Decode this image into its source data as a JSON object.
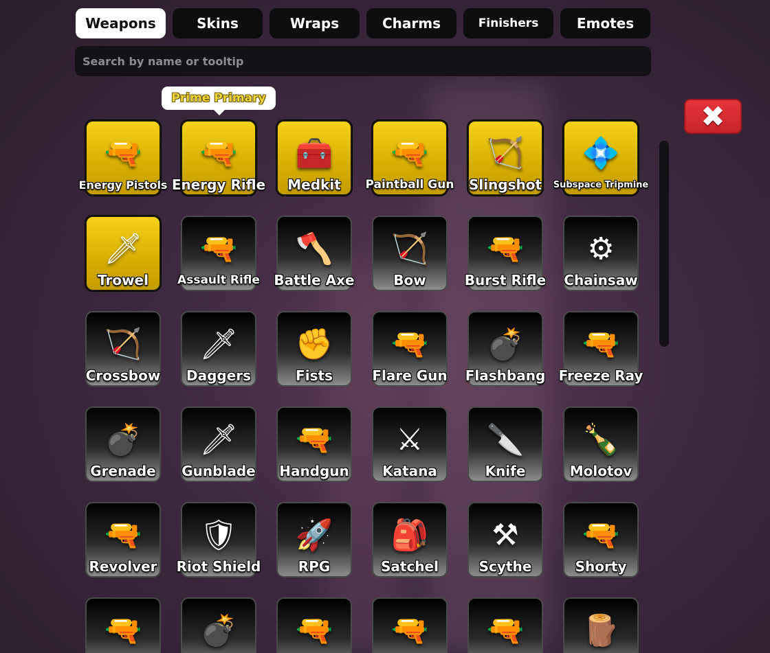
{
  "tabs": [
    {
      "label": "Weapons",
      "active": true
    },
    {
      "label": "Skins",
      "active": false
    },
    {
      "label": "Wraps",
      "active": false
    },
    {
      "label": "Charms",
      "active": false
    },
    {
      "label": "Finishers",
      "active": false
    },
    {
      "label": "Emotes",
      "active": false
    }
  ],
  "search": {
    "placeholder": "Search by name or tooltip",
    "value": ""
  },
  "tooltip": {
    "text": "Prime Primary"
  },
  "close": {
    "glyph": "✖"
  },
  "colors": {
    "prime": "#f6d21a",
    "close": "#e6353b",
    "tab_active": "#ffffff",
    "tab": "#0d0d10"
  },
  "items": [
    {
      "name": "Energy Pistols",
      "icon": "🔫",
      "prime": true
    },
    {
      "name": "Energy Rifle",
      "icon": "🔫",
      "prime": true
    },
    {
      "name": "Medkit",
      "icon": "🧰",
      "prime": true
    },
    {
      "name": "Paintball Gun",
      "icon": "🔫",
      "prime": true
    },
    {
      "name": "Slingshot",
      "icon": "🏹",
      "prime": true
    },
    {
      "name": "Subspace Tripmine",
      "icon": "💠",
      "prime": true
    },
    {
      "name": "Trowel",
      "icon": "🗡",
      "prime": true
    },
    {
      "name": "Assault Rifle",
      "icon": "🔫",
      "prime": false
    },
    {
      "name": "Battle Axe",
      "icon": "🪓",
      "prime": false
    },
    {
      "name": "Bow",
      "icon": "🏹",
      "prime": false
    },
    {
      "name": "Burst Rifle",
      "icon": "🔫",
      "prime": false
    },
    {
      "name": "Chainsaw",
      "icon": "⚙",
      "prime": false
    },
    {
      "name": "Crossbow",
      "icon": "🏹",
      "prime": false
    },
    {
      "name": "Daggers",
      "icon": "🗡",
      "prime": false
    },
    {
      "name": "Fists",
      "icon": "✊",
      "prime": false
    },
    {
      "name": "Flare Gun",
      "icon": "🔫",
      "prime": false
    },
    {
      "name": "Flashbang",
      "icon": "💣",
      "prime": false
    },
    {
      "name": "Freeze Ray",
      "icon": "🔫",
      "prime": false
    },
    {
      "name": "Grenade",
      "icon": "💣",
      "prime": false
    },
    {
      "name": "Gunblade",
      "icon": "🗡",
      "prime": false
    },
    {
      "name": "Handgun",
      "icon": "🔫",
      "prime": false
    },
    {
      "name": "Katana",
      "icon": "⚔",
      "prime": false
    },
    {
      "name": "Knife",
      "icon": "🔪",
      "prime": false
    },
    {
      "name": "Molotov",
      "icon": "🍾",
      "prime": false
    },
    {
      "name": "Revolver",
      "icon": "🔫",
      "prime": false
    },
    {
      "name": "Riot Shield",
      "icon": "🛡",
      "prime": false
    },
    {
      "name": "RPG",
      "icon": "🚀",
      "prime": false
    },
    {
      "name": "Satchel",
      "icon": "🎒",
      "prime": false
    },
    {
      "name": "Scythe",
      "icon": "⚒",
      "prime": false
    },
    {
      "name": "Shorty",
      "icon": "🔫",
      "prime": false
    },
    {
      "name": "",
      "icon": "🔫",
      "prime": false
    },
    {
      "name": "",
      "icon": "💣",
      "prime": false
    },
    {
      "name": "",
      "icon": "🔫",
      "prime": false
    },
    {
      "name": "",
      "icon": "🔫",
      "prime": false
    },
    {
      "name": "",
      "icon": "🔫",
      "prime": false
    },
    {
      "name": "",
      "icon": "🪵",
      "prime": false
    }
  ]
}
